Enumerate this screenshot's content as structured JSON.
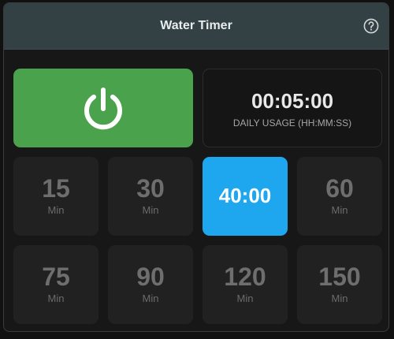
{
  "header": {
    "title": "Water Timer",
    "help_icon": "question-circle-icon"
  },
  "power": {
    "icon": "power-icon",
    "color": "#4aa24c"
  },
  "usage": {
    "value": "00:05:00",
    "label": "DAILY USAGE (HH:MM:SS)"
  },
  "durations": [
    {
      "value": "15",
      "unit": "Min",
      "active": false
    },
    {
      "value": "30",
      "unit": "Min",
      "active": false
    },
    {
      "value": "40:00",
      "unit": "",
      "active": true
    },
    {
      "value": "60",
      "unit": "Min",
      "active": false
    },
    {
      "value": "75",
      "unit": "Min",
      "active": false
    },
    {
      "value": "90",
      "unit": "Min",
      "active": false
    },
    {
      "value": "120",
      "unit": "Min",
      "active": false
    },
    {
      "value": "150",
      "unit": "Min",
      "active": false
    }
  ],
  "colors": {
    "active": "#1ea7ef",
    "header": "#334044"
  }
}
